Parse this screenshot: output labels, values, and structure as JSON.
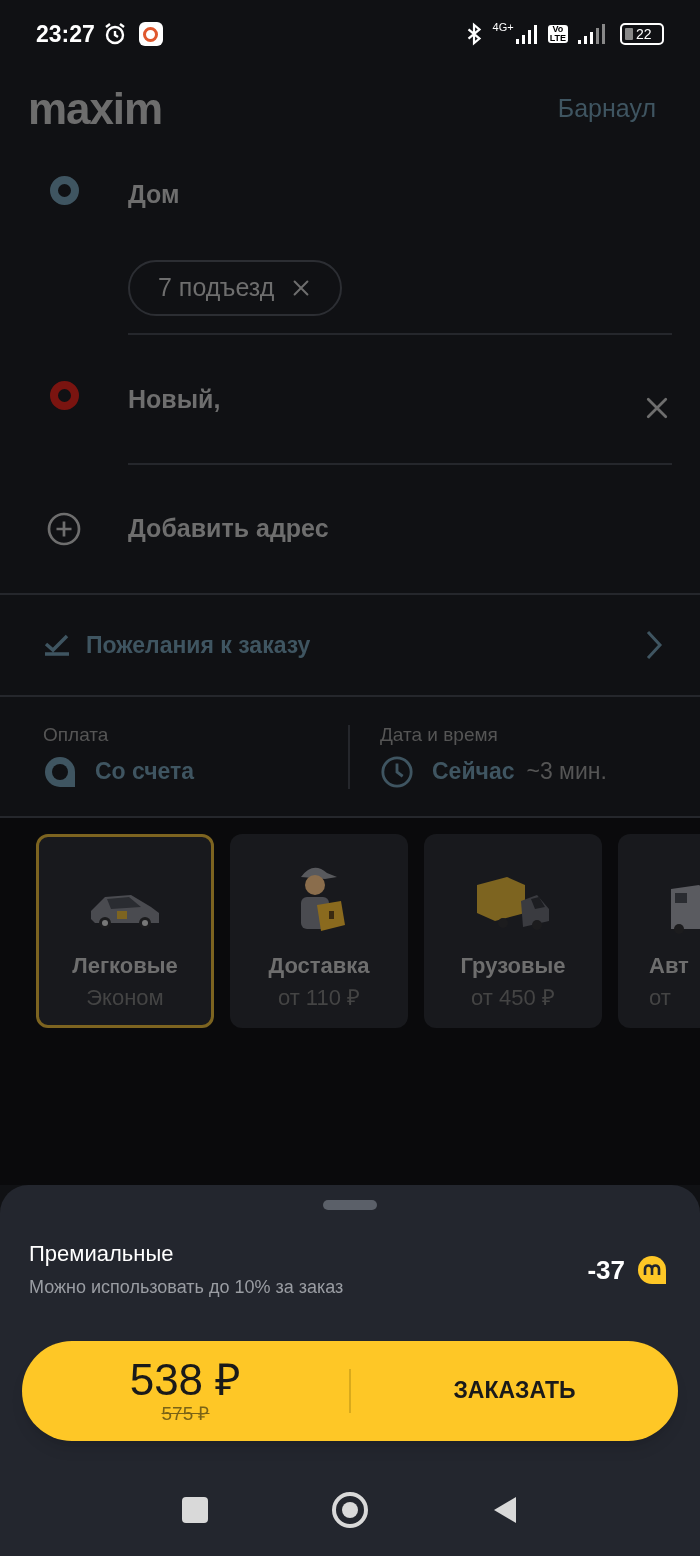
{
  "status_bar": {
    "time": "23:27",
    "network": "4G+",
    "volte": [
      "Vo",
      "LTE"
    ],
    "battery": "22"
  },
  "header": {
    "logo": "maxim",
    "city": "Барнаул"
  },
  "route": [
    {
      "kind": "origin",
      "title": "Дом",
      "chips": [
        "7 подъезд"
      ],
      "clearable": false
    },
    {
      "kind": "destination",
      "title": "Новый,",
      "clearable": true
    }
  ],
  "add_stop": "Добавить адрес",
  "wishes": "Пожелания к заказу",
  "payment": {
    "label": "Оплата",
    "value": "Со счета"
  },
  "datetime": {
    "label": "Дата и время",
    "value": "Сейчас",
    "eta": "~3 мин."
  },
  "categories": [
    {
      "kind": "car",
      "title": "Легковые",
      "subtitle": "Эконом",
      "selected": true
    },
    {
      "kind": "courier",
      "title": "Доставка",
      "subtitle": "от 110 ₽",
      "selected": false
    },
    {
      "kind": "truck",
      "title": "Грузовые",
      "subtitle": "от 450 ₽",
      "selected": false
    },
    {
      "kind": "bus",
      "title": "Авт",
      "subtitle": "от",
      "selected": false,
      "clipped": true
    }
  ],
  "bonus": {
    "title": "Премиальные",
    "subtitle": "Можно использовать до 10% за заказ",
    "amount": "-37"
  },
  "order": {
    "price": "538 ₽",
    "old_price": "575 ₽",
    "button": "ЗАКАЗАТЬ"
  }
}
